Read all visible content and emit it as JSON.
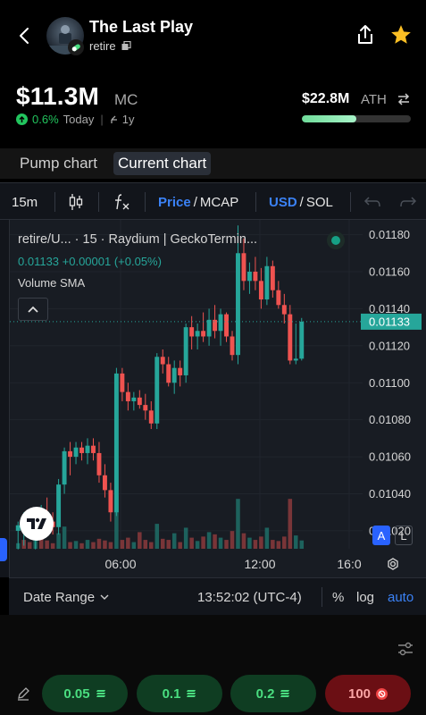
{
  "header": {
    "title": "The Last Play",
    "ticker": "retire"
  },
  "stats": {
    "mc_value": "$11.3M",
    "mc_label": "MC",
    "change_pct": "0.6%",
    "change_period": "Today",
    "history_label": "1y",
    "ath_value": "$22.8M",
    "ath_label": "ATH",
    "ath_progress": 0.5
  },
  "tabs": [
    {
      "label": "Pump chart",
      "active": false
    },
    {
      "label": "Current chart",
      "active": true
    }
  ],
  "toolbar": {
    "interval": "15m",
    "price_label": "Price",
    "mcap_label": "MCAP",
    "usd_label": "USD",
    "sol_label": "SOL",
    "slash": "/"
  },
  "chart": {
    "legend_title": "retire/U...  · 15 · Raydium | GeckoTermin...",
    "legend_values": "0.01133 +0.00001 (+0.05%)",
    "legend_indicator": "Volume SMA",
    "last_price": "0.01133",
    "scale_a": "A",
    "scale_l": "L"
  },
  "chart_data": {
    "type": "candlestick",
    "y_ticks": [
      "0.01180",
      "0.01160",
      "0.01140",
      "0.01120",
      "0.01100",
      "0.01080",
      "0.01060",
      "0.01040",
      "0.01020"
    ],
    "x_ticks": [
      "06:00",
      "12:00",
      "16:0"
    ],
    "ylim": [
      0.01005,
      0.01188
    ],
    "last_price": 0.01133,
    "up_color": "#26a69a",
    "down_color": "#ef5350",
    "candles": [
      {
        "o": 0.0102,
        "h": 0.01025,
        "l": 0.0101,
        "c": 0.01023
      },
      {
        "o": 0.01023,
        "h": 0.0103,
        "l": 0.01012,
        "c": 0.01025
      },
      {
        "o": 0.01025,
        "h": 0.01032,
        "l": 0.01016,
        "c": 0.0102
      },
      {
        "o": 0.0102,
        "h": 0.01028,
        "l": 0.0101,
        "c": 0.01026
      },
      {
        "o": 0.01026,
        "h": 0.01034,
        "l": 0.0102,
        "c": 0.01028
      },
      {
        "o": 0.01028,
        "h": 0.01038,
        "l": 0.01022,
        "c": 0.01025
      },
      {
        "o": 0.01025,
        "h": 0.0103,
        "l": 0.01018,
        "c": 0.01022
      },
      {
        "o": 0.01022,
        "h": 0.01048,
        "l": 0.01018,
        "c": 0.01045
      },
      {
        "o": 0.01045,
        "h": 0.01065,
        "l": 0.0104,
        "c": 0.01063
      },
      {
        "o": 0.01063,
        "h": 0.01068,
        "l": 0.0105,
        "c": 0.0106
      },
      {
        "o": 0.0106,
        "h": 0.01068,
        "l": 0.01056,
        "c": 0.01065
      },
      {
        "o": 0.01065,
        "h": 0.01068,
        "l": 0.01058,
        "c": 0.01062
      },
      {
        "o": 0.01062,
        "h": 0.0107,
        "l": 0.01056,
        "c": 0.01066
      },
      {
        "o": 0.01066,
        "h": 0.0107,
        "l": 0.01058,
        "c": 0.01062
      },
      {
        "o": 0.01062,
        "h": 0.01068,
        "l": 0.01046,
        "c": 0.0105
      },
      {
        "o": 0.0105,
        "h": 0.01056,
        "l": 0.01038,
        "c": 0.01042
      },
      {
        "o": 0.01042,
        "h": 0.01046,
        "l": 0.01025,
        "c": 0.0103
      },
      {
        "o": 0.0103,
        "h": 0.01108,
        "l": 0.01028,
        "c": 0.01105
      },
      {
        "o": 0.01105,
        "h": 0.01108,
        "l": 0.0109,
        "c": 0.01095
      },
      {
        "o": 0.01095,
        "h": 0.011,
        "l": 0.01085,
        "c": 0.0109
      },
      {
        "o": 0.0109,
        "h": 0.01095,
        "l": 0.01085,
        "c": 0.01092
      },
      {
        "o": 0.01092,
        "h": 0.01096,
        "l": 0.01086,
        "c": 0.01088
      },
      {
        "o": 0.01088,
        "h": 0.01094,
        "l": 0.0108,
        "c": 0.01085
      },
      {
        "o": 0.01085,
        "h": 0.0109,
        "l": 0.01075,
        "c": 0.01078
      },
      {
        "o": 0.01078,
        "h": 0.01116,
        "l": 0.01075,
        "c": 0.01114
      },
      {
        "o": 0.01114,
        "h": 0.01118,
        "l": 0.01105,
        "c": 0.0111
      },
      {
        "o": 0.0111,
        "h": 0.01114,
        "l": 0.01098,
        "c": 0.011
      },
      {
        "o": 0.011,
        "h": 0.01112,
        "l": 0.01094,
        "c": 0.01108
      },
      {
        "o": 0.01108,
        "h": 0.01112,
        "l": 0.01098,
        "c": 0.01104
      },
      {
        "o": 0.01104,
        "h": 0.01132,
        "l": 0.011,
        "c": 0.0113
      },
      {
        "o": 0.0113,
        "h": 0.01136,
        "l": 0.01118,
        "c": 0.01125
      },
      {
        "o": 0.01125,
        "h": 0.01132,
        "l": 0.01118,
        "c": 0.01128
      },
      {
        "o": 0.01128,
        "h": 0.01138,
        "l": 0.01122,
        "c": 0.01125
      },
      {
        "o": 0.01125,
        "h": 0.0114,
        "l": 0.0112,
        "c": 0.01134
      },
      {
        "o": 0.01134,
        "h": 0.01142,
        "l": 0.01124,
        "c": 0.01128
      },
      {
        "o": 0.01128,
        "h": 0.0114,
        "l": 0.0112,
        "c": 0.01137
      },
      {
        "o": 0.01137,
        "h": 0.01138,
        "l": 0.01122,
        "c": 0.01125
      },
      {
        "o": 0.01125,
        "h": 0.01128,
        "l": 0.01112,
        "c": 0.01115
      },
      {
        "o": 0.01115,
        "h": 0.01185,
        "l": 0.0111,
        "c": 0.0117
      },
      {
        "o": 0.0117,
        "h": 0.01178,
        "l": 0.0115,
        "c": 0.01155
      },
      {
        "o": 0.01155,
        "h": 0.01165,
        "l": 0.01148,
        "c": 0.0116
      },
      {
        "o": 0.0116,
        "h": 0.01168,
        "l": 0.0115,
        "c": 0.01155
      },
      {
        "o": 0.01155,
        "h": 0.01162,
        "l": 0.0114,
        "c": 0.01145
      },
      {
        "o": 0.01145,
        "h": 0.01168,
        "l": 0.01142,
        "c": 0.01163
      },
      {
        "o": 0.01163,
        "h": 0.01166,
        "l": 0.01146,
        "c": 0.0115
      },
      {
        "o": 0.0115,
        "h": 0.01155,
        "l": 0.0114,
        "c": 0.01142
      },
      {
        "o": 0.01142,
        "h": 0.01148,
        "l": 0.01132,
        "c": 0.01137
      },
      {
        "o": 0.01137,
        "h": 0.01142,
        "l": 0.0111,
        "c": 0.01112
      },
      {
        "o": 0.01112,
        "h": 0.01132,
        "l": 0.0111,
        "c": 0.01113
      },
      {
        "o": 0.01113,
        "h": 0.01135,
        "l": 0.01112,
        "c": 0.01133
      }
    ],
    "volumes": [
      {
        "v": 0.1,
        "up": true
      },
      {
        "v": 0.16,
        "up": false
      },
      {
        "v": 0.12,
        "up": false
      },
      {
        "v": 0.18,
        "up": true
      },
      {
        "v": 0.22,
        "up": false
      },
      {
        "v": 0.15,
        "up": false
      },
      {
        "v": 0.1,
        "up": false
      },
      {
        "v": 0.28,
        "up": true
      },
      {
        "v": 0.4,
        "up": true
      },
      {
        "v": 0.12,
        "up": false
      },
      {
        "v": 0.14,
        "up": true
      },
      {
        "v": 0.1,
        "up": false
      },
      {
        "v": 0.16,
        "up": true
      },
      {
        "v": 0.12,
        "up": false
      },
      {
        "v": 0.18,
        "up": false
      },
      {
        "v": 0.15,
        "up": false
      },
      {
        "v": 0.12,
        "up": false
      },
      {
        "v": 0.95,
        "up": true
      },
      {
        "v": 0.16,
        "up": false
      },
      {
        "v": 0.2,
        "up": false
      },
      {
        "v": 0.12,
        "up": true
      },
      {
        "v": 0.3,
        "up": false
      },
      {
        "v": 0.16,
        "up": false
      },
      {
        "v": 0.12,
        "up": false
      },
      {
        "v": 0.45,
        "up": true
      },
      {
        "v": 0.18,
        "up": false
      },
      {
        "v": 0.16,
        "up": false
      },
      {
        "v": 0.28,
        "up": true
      },
      {
        "v": 0.12,
        "up": false
      },
      {
        "v": 0.38,
        "up": true
      },
      {
        "v": 0.2,
        "up": false
      },
      {
        "v": 0.14,
        "up": true
      },
      {
        "v": 0.22,
        "up": false
      },
      {
        "v": 0.3,
        "up": true
      },
      {
        "v": 0.26,
        "up": false
      },
      {
        "v": 0.2,
        "up": true
      },
      {
        "v": 0.16,
        "up": false
      },
      {
        "v": 0.32,
        "up": false
      },
      {
        "v": 0.9,
        "up": true
      },
      {
        "v": 0.28,
        "up": false
      },
      {
        "v": 0.2,
        "up": true
      },
      {
        "v": 0.16,
        "up": false
      },
      {
        "v": 0.22,
        "up": false
      },
      {
        "v": 0.38,
        "up": true
      },
      {
        "v": 0.16,
        "up": false
      },
      {
        "v": 0.14,
        "up": false
      },
      {
        "v": 0.22,
        "up": false
      },
      {
        "v": 0.9,
        "up": false
      },
      {
        "v": 0.24,
        "up": true
      },
      {
        "v": 0.15,
        "up": true
      }
    ]
  },
  "datebar": {
    "date_range": "Date Range",
    "time": "13:52:02 (UTC-4)",
    "pct": "%",
    "log": "log",
    "auto": "auto"
  },
  "quickbuy": [
    {
      "label": "0.05",
      "kind": "buy"
    },
    {
      "label": "0.1",
      "kind": "buy"
    },
    {
      "label": "0.2",
      "kind": "buy"
    },
    {
      "label": "100",
      "kind": "sell"
    }
  ],
  "colors": {
    "accent": "#2962ff",
    "up": "#26a69a",
    "down": "#ef5350",
    "buy_text": "#4ade80",
    "sell_bg": "#6b0f14"
  }
}
